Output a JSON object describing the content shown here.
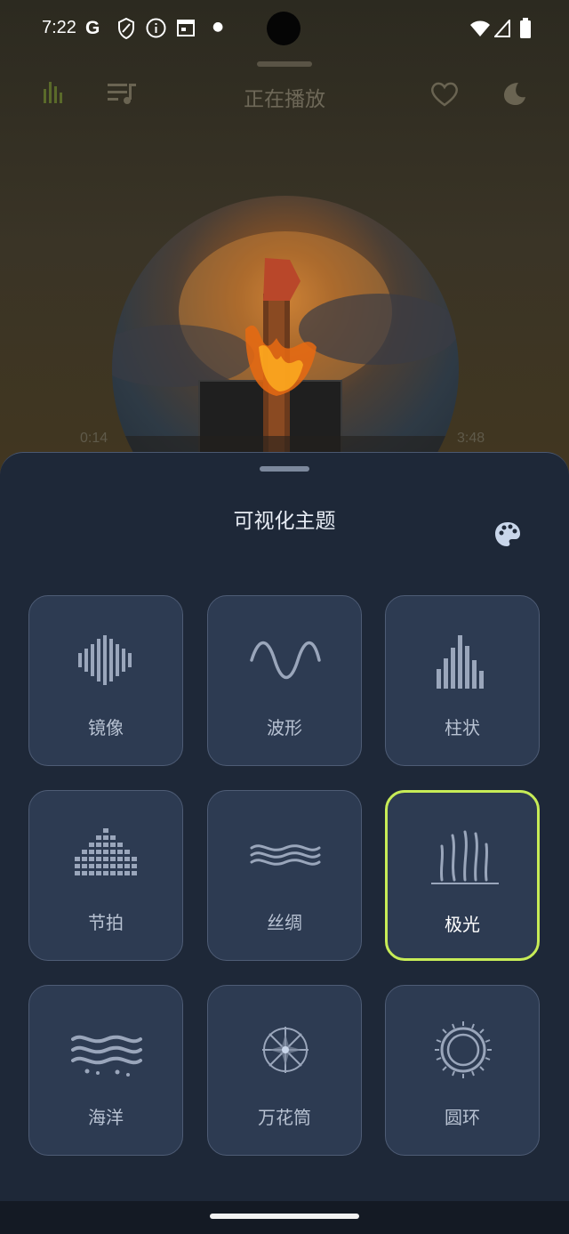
{
  "status_bar": {
    "time": "7:22"
  },
  "top_bar": {
    "title": "正在播放"
  },
  "player": {
    "elapsed": "0:14",
    "duration": "3:48"
  },
  "sheet": {
    "title": "可视化主题",
    "themes": [
      {
        "label": "镜像",
        "icon": "mirror-icon",
        "selected": false
      },
      {
        "label": "波形",
        "icon": "wave-icon",
        "selected": false
      },
      {
        "label": "柱状",
        "icon": "bars-icon",
        "selected": false
      },
      {
        "label": "节拍",
        "icon": "beat-icon",
        "selected": false
      },
      {
        "label": "丝绸",
        "icon": "silk-icon",
        "selected": false
      },
      {
        "label": "极光",
        "icon": "aurora-icon",
        "selected": true
      },
      {
        "label": "海洋",
        "icon": "ocean-icon",
        "selected": false
      },
      {
        "label": "万花筒",
        "icon": "kaleidoscope-icon",
        "selected": false
      },
      {
        "label": "圆环",
        "icon": "ring-icon",
        "selected": false
      }
    ]
  },
  "colors": {
    "sheet_bg": "#1e2838",
    "card_bg": "#2d3b52",
    "selected_border": "#c7ec57",
    "icon": "#9aa6bb"
  }
}
